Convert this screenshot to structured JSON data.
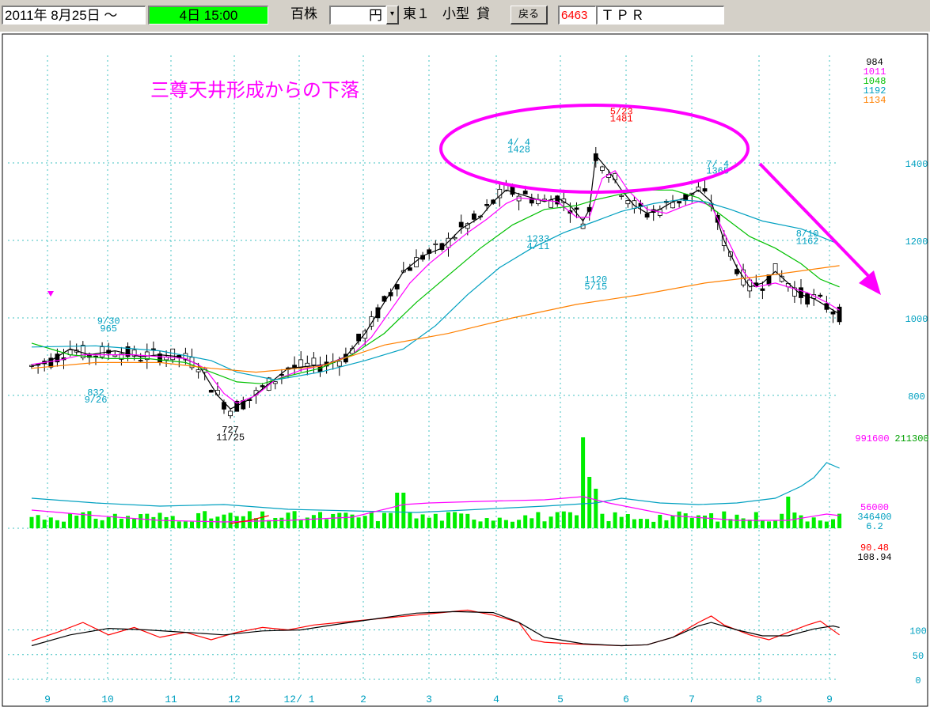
{
  "toolbar": {
    "date_from": "2011年 8月25日 ～",
    "period": "4日 15:00",
    "unit": "百株",
    "currency": "円",
    "market": "東１",
    "size": "小型",
    "margin": "貸",
    "back_label": "戻る",
    "code": "6463",
    "name": "ＴＰＲ",
    "dropdown_icon": "chevron-down-icon",
    "accent_period": "#00ff00",
    "accent_code": "#ff0000"
  },
  "chart_data": {
    "type": "candlestick",
    "title": "三尊天井形成からの下落",
    "x_ticks": [
      "9",
      "10",
      "11",
      "12",
      "12/ 1",
      "2",
      "3",
      "4",
      "5",
      "6",
      "7",
      "8",
      "9"
    ],
    "y_ticks": [
      {
        "v": 1400,
        "label": "1400"
      },
      {
        "v": 1200,
        "label": "1200"
      },
      {
        "v": 1000,
        "label": "1000"
      },
      {
        "v": 800,
        "label": "800"
      }
    ],
    "ma_readouts": [
      {
        "label": "984",
        "color": "#000000"
      },
      {
        "label": "1011",
        "color": "#ff00ff"
      },
      {
        "label": "1048",
        "color": "#00c000"
      },
      {
        "label": "1192",
        "color": "#00a0c0"
      },
      {
        "label": "1134",
        "color": "#ff8000"
      }
    ],
    "price_series": [
      {
        "name": "short-ma",
        "color": "#000000",
        "points": [
          [
            0,
            875
          ],
          [
            3,
            890
          ],
          [
            6,
            920
          ],
          [
            9,
            905
          ],
          [
            13,
            915
          ],
          [
            17,
            900
          ],
          [
            20,
            905
          ],
          [
            23,
            900
          ],
          [
            26,
            880
          ],
          [
            29,
            800
          ],
          [
            31,
            765
          ],
          [
            34,
            790
          ],
          [
            37,
            830
          ],
          [
            40,
            870
          ],
          [
            43,
            875
          ],
          [
            46,
            880
          ],
          [
            49,
            900
          ],
          [
            52,
            960
          ],
          [
            55,
            1040
          ],
          [
            58,
            1120
          ],
          [
            61,
            1160
          ],
          [
            64,
            1180
          ],
          [
            67,
            1230
          ],
          [
            70,
            1260
          ],
          [
            72,
            1300
          ],
          [
            74,
            1330
          ],
          [
            76,
            1320
          ],
          [
            78,
            1310
          ],
          [
            80,
            1300
          ],
          [
            82,
            1310
          ],
          [
            84,
            1290
          ],
          [
            86,
            1250
          ],
          [
            87,
            1280
          ],
          [
            88,
            1420
          ],
          [
            90,
            1380
          ],
          [
            92,
            1330
          ],
          [
            94,
            1290
          ],
          [
            96,
            1270
          ],
          [
            98,
            1280
          ],
          [
            100,
            1300
          ],
          [
            102,
            1310
          ],
          [
            104,
            1330
          ],
          [
            106,
            1300
          ],
          [
            108,
            1200
          ],
          [
            110,
            1130
          ],
          [
            112,
            1080
          ],
          [
            114,
            1090
          ],
          [
            116,
            1120
          ],
          [
            118,
            1090
          ],
          [
            120,
            1060
          ],
          [
            122,
            1050
          ],
          [
            124,
            1030
          ],
          [
            126,
            1010
          ]
        ]
      },
      {
        "name": "ma-25",
        "color": "#ff00ff",
        "points": [
          [
            0,
            880
          ],
          [
            4,
            890
          ],
          [
            8,
            905
          ],
          [
            12,
            905
          ],
          [
            16,
            905
          ],
          [
            20,
            900
          ],
          [
            24,
            895
          ],
          [
            27,
            870
          ],
          [
            30,
            805
          ],
          [
            32,
            780
          ],
          [
            35,
            800
          ],
          [
            38,
            840
          ],
          [
            42,
            865
          ],
          [
            46,
            880
          ],
          [
            50,
            905
          ],
          [
            53,
            950
          ],
          [
            56,
            1020
          ],
          [
            59,
            1090
          ],
          [
            62,
            1140
          ],
          [
            65,
            1180
          ],
          [
            68,
            1220
          ],
          [
            71,
            1255
          ],
          [
            74,
            1295
          ],
          [
            76,
            1310
          ],
          [
            79,
            1305
          ],
          [
            82,
            1300
          ],
          [
            85,
            1260
          ],
          [
            87,
            1260
          ],
          [
            89,
            1360
          ],
          [
            91,
            1380
          ],
          [
            93,
            1330
          ],
          [
            96,
            1280
          ],
          [
            99,
            1270
          ],
          [
            102,
            1290
          ],
          [
            104,
            1300
          ],
          [
            106,
            1290
          ],
          [
            108,
            1220
          ],
          [
            111,
            1120
          ],
          [
            113,
            1080
          ],
          [
            116,
            1090
          ],
          [
            118,
            1080
          ],
          [
            121,
            1065
          ],
          [
            124,
            1040
          ],
          [
            126,
            1020
          ]
        ]
      },
      {
        "name": "ma-75",
        "color": "#00c000",
        "points": [
          [
            0,
            935
          ],
          [
            6,
            905
          ],
          [
            12,
            895
          ],
          [
            18,
            895
          ],
          [
            24,
            885
          ],
          [
            28,
            860
          ],
          [
            32,
            835
          ],
          [
            36,
            830
          ],
          [
            40,
            850
          ],
          [
            45,
            870
          ],
          [
            50,
            905
          ],
          [
            55,
            960
          ],
          [
            60,
            1040
          ],
          [
            65,
            1110
          ],
          [
            70,
            1180
          ],
          [
            75,
            1240
          ],
          [
            80,
            1280
          ],
          [
            85,
            1290
          ],
          [
            88,
            1305
          ],
          [
            92,
            1320
          ],
          [
            96,
            1330
          ],
          [
            100,
            1330
          ],
          [
            104,
            1310
          ],
          [
            108,
            1260
          ],
          [
            112,
            1210
          ],
          [
            116,
            1180
          ],
          [
            120,
            1140
          ],
          [
            123,
            1100
          ],
          [
            126,
            1080
          ]
        ]
      },
      {
        "name": "ma-200",
        "color": "#00a0c0",
        "points": [
          [
            0,
            925
          ],
          [
            10,
            928
          ],
          [
            20,
            915
          ],
          [
            28,
            890
          ],
          [
            32,
            860
          ],
          [
            38,
            840
          ],
          [
            45,
            860
          ],
          [
            52,
            890
          ],
          [
            58,
            920
          ],
          [
            63,
            980
          ],
          [
            68,
            1060
          ],
          [
            73,
            1130
          ],
          [
            78,
            1180
          ],
          [
            83,
            1220
          ],
          [
            88,
            1250
          ],
          [
            92,
            1275
          ],
          [
            97,
            1295
          ],
          [
            101,
            1305
          ],
          [
            105,
            1300
          ],
          [
            109,
            1280
          ],
          [
            114,
            1250
          ],
          [
            120,
            1230
          ],
          [
            126,
            1190
          ]
        ]
      },
      {
        "name": "ma-long",
        "color": "#ff8000",
        "points": [
          [
            0,
            870
          ],
          [
            10,
            885
          ],
          [
            20,
            885
          ],
          [
            28,
            870
          ],
          [
            35,
            860
          ],
          [
            45,
            875
          ],
          [
            55,
            930
          ],
          [
            65,
            960
          ],
          [
            75,
            1000
          ],
          [
            85,
            1035
          ],
          [
            95,
            1060
          ],
          [
            105,
            1090
          ],
          [
            115,
            1110
          ],
          [
            126,
            1135
          ]
        ]
      }
    ],
    "price_annotations": [
      {
        "label": "9/30",
        "x": 12,
        "y": 985,
        "color": "#00a0c0"
      },
      {
        "label": "965",
        "x": 12,
        "y": 965,
        "color": "#00a0c0"
      },
      {
        "label": "832",
        "x": 10,
        "y": 800,
        "color": "#00a0c0"
      },
      {
        "label": "9/26",
        "x": 10,
        "y": 782,
        "color": "#00a0c0"
      },
      {
        "label": "727",
        "x": 31,
        "y": 704,
        "color": "#000000"
      },
      {
        "label": "11/25",
        "x": 31,
        "y": 685,
        "color": "#000000"
      },
      {
        "label": "4/ 4",
        "x": 76,
        "y": 1446,
        "color": "#00a0c0"
      },
      {
        "label": "1428",
        "x": 76,
        "y": 1428,
        "color": "#00a0c0"
      },
      {
        "label": "1233",
        "x": 79,
        "y": 1197,
        "color": "#00a0c0"
      },
      {
        "label": "4/11",
        "x": 79,
        "y": 1178,
        "color": "#00a0c0"
      },
      {
        "label": "5/23",
        "x": 92,
        "y": 1526,
        "color": "#ff0000"
      },
      {
        "label": "1481",
        "x": 92,
        "y": 1507,
        "color": "#ff0000"
      },
      {
        "label": "1120",
        "x": 88,
        "y": 1092,
        "color": "#00a0c0"
      },
      {
        "label": "5/15",
        "x": 88,
        "y": 1073,
        "color": "#00a0c0"
      },
      {
        "label": "7/ 4",
        "x": 107,
        "y": 1390,
        "color": "#00a0c0"
      },
      {
        "label": "1365",
        "x": 107,
        "y": 1372,
        "color": "#00a0c0"
      },
      {
        "label": "8/10",
        "x": 121,
        "y": 1210,
        "color": "#00a0c0"
      },
      {
        "label": "1162",
        "x": 121,
        "y": 1191,
        "color": "#00a0c0"
      }
    ],
    "volume_readouts": [
      {
        "label": "991600",
        "color": "#ff00ff"
      },
      {
        "label": "211300",
        "color": "#00a000"
      },
      {
        "label": "56000",
        "color": "#ff00ff"
      },
      {
        "label": "346400",
        "color": "#00a0c0"
      },
      {
        "label": "6.2",
        "color": "#00a0c0"
      }
    ],
    "oscillator": {
      "readouts": [
        {
          "label": "90.48",
          "color": "#ff0000"
        },
        {
          "label": "108.94",
          "color": "#000000"
        }
      ],
      "y_ticks": [
        {
          "v": 100,
          "label": "100"
        },
        {
          "v": 50,
          "label": "50"
        },
        {
          "v": 0,
          "label": "0"
        }
      ],
      "series": [
        {
          "name": "fast",
          "color": "#ff0000",
          "points": [
            [
              0,
              78
            ],
            [
              4,
              95
            ],
            [
              8,
              115
            ],
            [
              12,
              90
            ],
            [
              16,
              105
            ],
            [
              20,
              85
            ],
            [
              24,
              95
            ],
            [
              28,
              80
            ],
            [
              32,
              95
            ],
            [
              36,
              105
            ],
            [
              40,
              100
            ],
            [
              44,
              110
            ],
            [
              48,
              115
            ],
            [
              52,
              120
            ],
            [
              56,
              125
            ],
            [
              60,
              130
            ],
            [
              64,
              135
            ],
            [
              68,
              140
            ],
            [
              72,
              130
            ],
            [
              76,
              115
            ],
            [
              78,
              80
            ],
            [
              80,
              75
            ],
            [
              84,
              72
            ],
            [
              88,
              70
            ],
            [
              92,
              68
            ],
            [
              96,
              70
            ],
            [
              100,
              85
            ],
            [
              104,
              115
            ],
            [
              106,
              128
            ],
            [
              108,
              110
            ],
            [
              112,
              90
            ],
            [
              115,
              80
            ],
            [
              118,
              95
            ],
            [
              121,
              110
            ],
            [
              123,
              118
            ],
            [
              126,
              90
            ]
          ]
        },
        {
          "name": "slow",
          "color": "#000000",
          "points": [
            [
              0,
              68
            ],
            [
              6,
              90
            ],
            [
              12,
              103
            ],
            [
              18,
              100
            ],
            [
              24,
              95
            ],
            [
              30,
              90
            ],
            [
              36,
              98
            ],
            [
              42,
              100
            ],
            [
              48,
              112
            ],
            [
              54,
              123
            ],
            [
              60,
              134
            ],
            [
              66,
              137
            ],
            [
              72,
              135
            ],
            [
              76,
              115
            ],
            [
              80,
              85
            ],
            [
              86,
              72
            ],
            [
              92,
              68
            ],
            [
              96,
              70
            ],
            [
              100,
              85
            ],
            [
              104,
              108
            ],
            [
              106,
              115
            ],
            [
              110,
              100
            ],
            [
              114,
              88
            ],
            [
              118,
              88
            ],
            [
              122,
              102
            ],
            [
              125,
              108
            ],
            [
              126,
              105
            ]
          ]
        }
      ]
    },
    "ylim": [
      650,
      1550
    ],
    "grid": true,
    "arrow": "down-right"
  }
}
